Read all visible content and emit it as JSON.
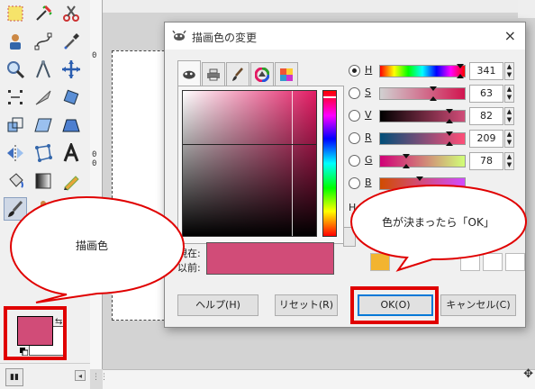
{
  "toolbox": {
    "tools": [
      {
        "name": "rect-select-tool",
        "icon": "rect-select-icon"
      },
      {
        "name": "fuzzy-select-tool",
        "icon": "fuzzy-select-icon"
      },
      {
        "name": "scissors-tool",
        "icon": "scissors-icon"
      },
      {
        "name": "foreground-select-tool",
        "icon": "foreground-select-icon"
      },
      {
        "name": "paths-tool",
        "icon": "paths-icon"
      },
      {
        "name": "color-picker-tool",
        "icon": "color-picker-icon"
      },
      {
        "name": "zoom-tool",
        "icon": "magnifier-icon"
      },
      {
        "name": "measure-tool",
        "icon": "compass-icon"
      },
      {
        "name": "move-tool",
        "icon": "move-arrows-icon"
      },
      {
        "name": "align-tool",
        "icon": "align-icon"
      },
      {
        "name": "crop-tool",
        "icon": "knife-icon"
      },
      {
        "name": "rotate-tool",
        "icon": "rotate-icon"
      },
      {
        "name": "scale-tool",
        "icon": "scale-icon"
      },
      {
        "name": "shear-tool",
        "icon": "shear-icon"
      },
      {
        "name": "perspective-tool",
        "icon": "perspective-icon"
      },
      {
        "name": "flip-tool",
        "icon": "flip-icon"
      },
      {
        "name": "cage-tool",
        "icon": "cage-icon"
      },
      {
        "name": "text-tool",
        "icon": "text-a-icon"
      },
      {
        "name": "bucket-fill-tool",
        "icon": "bucket-icon"
      },
      {
        "name": "blend-tool",
        "icon": "gradient-icon"
      },
      {
        "name": "pencil-tool",
        "icon": "pencil-icon"
      },
      {
        "name": "paintbrush-tool",
        "icon": "paintbrush-icon"
      },
      {
        "name": "clone-tool",
        "icon": "stamp-icon"
      },
      {
        "name": "smudge-tool",
        "icon": "ink-icon"
      }
    ],
    "foreground_color": "#d14c78",
    "background_color": "#ffffff",
    "highlight_color": "#e00000"
  },
  "ruler": {
    "vertical_labels": [
      "0",
      "0",
      "0"
    ]
  },
  "dialog": {
    "title": "描画色の変更",
    "close_label": "×",
    "tabs": [
      "gimp-tab-icon",
      "printer-tab-icon",
      "brush-tab-icon",
      "wheel-tab-icon",
      "palette-tab-icon"
    ],
    "current_label": "現在:",
    "previous_label": "以前:",
    "current_color": "#d14c78",
    "channels": [
      {
        "key": "H",
        "value": "341",
        "selected": true,
        "marker_fraction": 0.95
      },
      {
        "key": "S",
        "value": "63",
        "selected": false,
        "marker_fraction": 0.63
      },
      {
        "key": "V",
        "value": "82",
        "selected": false,
        "marker_fraction": 0.82
      },
      {
        "key": "R",
        "value": "209",
        "selected": false,
        "marker_fraction": 0.82
      },
      {
        "key": "G",
        "value": "78",
        "selected": false,
        "marker_fraction": 0.31
      },
      {
        "key": "B",
        "value": "",
        "selected": false,
        "marker_fraction": 0.47
      }
    ],
    "hex_label_partial": "H",
    "buttons": {
      "help": "ヘルプ(H)",
      "reset": "リセット(R)",
      "ok": "OK(O)",
      "cancel": "キャンセル(C)"
    }
  },
  "callouts": {
    "left": "描画色",
    "right": "色が決まったら「OK」"
  }
}
